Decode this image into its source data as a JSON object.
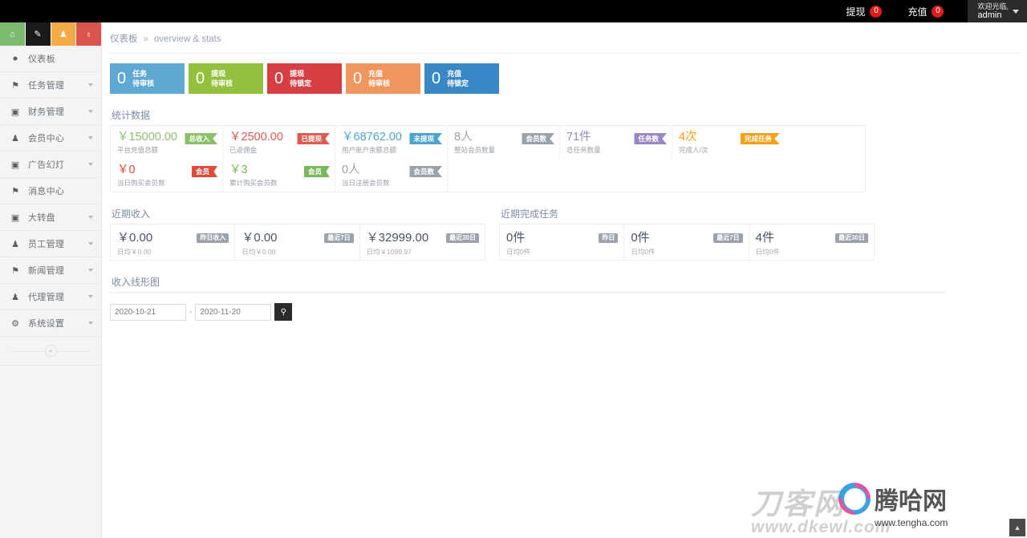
{
  "topbar": {
    "withdraw_label": "提现",
    "withdraw_count": "0",
    "recharge_label": "充值",
    "recharge_count": "0",
    "welcome": "欢迎光临,",
    "username": "admin"
  },
  "sidebar": {
    "quick_icons": [
      {
        "name": "home-icon",
        "glyph": "⌂",
        "color": "#7cbb6e"
      },
      {
        "name": "pencil-icon",
        "glyph": "✎",
        "color": "#1a1a1a"
      },
      {
        "name": "users-icon",
        "glyph": "♟",
        "color": "#f5ab45"
      },
      {
        "name": "bell-icon",
        "glyph": "♁",
        "color": "#d9534f"
      }
    ],
    "items": [
      {
        "label": "仪表板",
        "icon": "dashboard-icon",
        "glyph": "⚫",
        "arrow": false
      },
      {
        "label": "任务管理",
        "icon": "flag-icon",
        "glyph": "⚑",
        "arrow": true
      },
      {
        "label": "财务管理",
        "icon": "inbox-icon",
        "glyph": "▣",
        "arrow": true
      },
      {
        "label": "会员中心",
        "icon": "user-icon",
        "glyph": "♟",
        "arrow": true
      },
      {
        "label": "广告幻灯",
        "icon": "image-icon",
        "glyph": "▣",
        "arrow": true
      },
      {
        "label": "消息中心",
        "icon": "bookmark-icon",
        "glyph": "⚑",
        "arrow": false
      },
      {
        "label": "大转盘",
        "icon": "inbox-icon",
        "glyph": "▣",
        "arrow": true
      },
      {
        "label": "员工管理",
        "icon": "user-icon",
        "glyph": "♟",
        "arrow": true
      },
      {
        "label": "新闻管理",
        "icon": "bookmark-icon",
        "glyph": "⚑",
        "arrow": true
      },
      {
        "label": "代理管理",
        "icon": "user-icon",
        "glyph": "♟",
        "arrow": true
      },
      {
        "label": "系统设置",
        "icon": "gear-icon",
        "glyph": "⚙",
        "arrow": true
      }
    ],
    "collapse_glyph": "«"
  },
  "breadcrumb": {
    "crumb1": "仪表板",
    "sep": "»",
    "crumb2": "overview & stats"
  },
  "status_cards": [
    {
      "num": "0",
      "line1": "任务",
      "line2": "待审核",
      "color": "#5fa8d3"
    },
    {
      "num": "0",
      "line1": "提现",
      "line2": "待审核",
      "color": "#93c13d"
    },
    {
      "num": "0",
      "line1": "提现",
      "line2": "待锁定",
      "color": "#d53f43"
    },
    {
      "num": "0",
      "line1": "充值",
      "line2": "待审核",
      "color": "#f0955e"
    },
    {
      "num": "0",
      "line1": "充值",
      "line2": "待锁定",
      "color": "#3a87c6"
    }
  ],
  "stats": {
    "title": "统计数据",
    "cells": [
      {
        "value": "￥15000.00",
        "caption": "平台充值总额",
        "ribbon": "总收入",
        "color": "#8cbf6a"
      },
      {
        "value": "￥2500.00",
        "caption": "已返佣金",
        "ribbon": "已提现",
        "color": "#dd5b51"
      },
      {
        "value": "￥68762.00",
        "caption": "用户账户余额总额",
        "ribbon": "未提现",
        "color": "#4da3cf"
      },
      {
        "value": "8人",
        "caption": "整站会员数量",
        "ribbon": "会员数",
        "color": "#9aa3ab"
      },
      {
        "value": "71件",
        "caption": "总任务数量",
        "ribbon": "任务数",
        "color": "#9a86c4"
      },
      {
        "value": "4次",
        "caption": "完成人/次",
        "ribbon": "完成任务",
        "color": "#f6a01a"
      },
      {
        "value": "￥0",
        "caption": "当日购买会员数",
        "ribbon": "会员",
        "color": "#dd4b39"
      },
      {
        "value": "￥3",
        "caption": "累计购买会员数",
        "ribbon": "会员",
        "color": "#7ab85c"
      },
      {
        "value": "0人",
        "caption": "当日注册会员数",
        "ribbon": "会员数",
        "color": "#9aa3ab"
      }
    ]
  },
  "recent_income": {
    "title": "近期收入",
    "cells": [
      {
        "value": "￥0.00",
        "caption": "日均￥0.00",
        "tag": "昨日收入"
      },
      {
        "value": "￥0.00",
        "caption": "日均￥0.00",
        "tag": "最近7日"
      },
      {
        "value": "￥32999.00",
        "caption": "日均￥1099.97",
        "tag": "最近30日"
      }
    ]
  },
  "recent_tasks": {
    "title": "近期完成任务",
    "cells": [
      {
        "value": "0件",
        "caption": "日均0件",
        "tag": "昨日"
      },
      {
        "value": "0件",
        "caption": "日均0件",
        "tag": "最近7日"
      },
      {
        "value": "4件",
        "caption": "日均0件",
        "tag": "最近30日"
      }
    ]
  },
  "chart_section": {
    "title": "收入线形图",
    "date_from": "2020-10-21",
    "date_to": "2020-11-20",
    "dash": "-",
    "search_glyph": "⚲"
  },
  "watermarks": {
    "wm1_main": "刀客网",
    "wm1_sub": "www.dkewl.com",
    "wm2_main": "腾哈网",
    "wm2_sub": "www.tengha.com"
  },
  "totop_glyph": "▲"
}
